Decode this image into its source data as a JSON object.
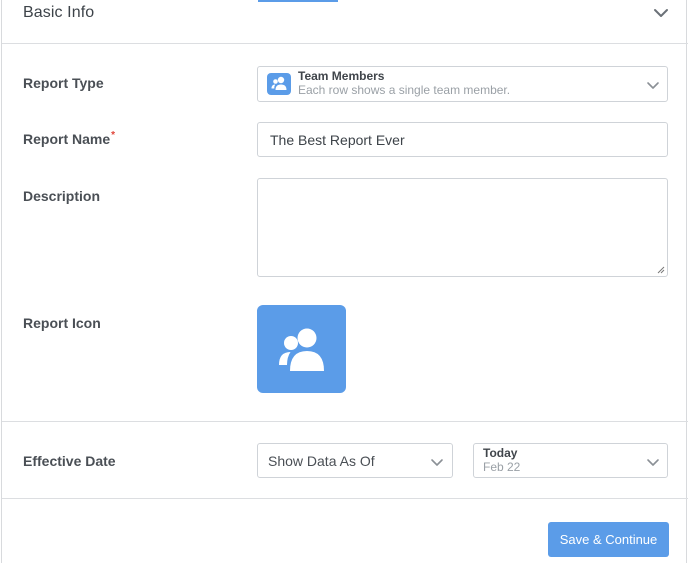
{
  "header": {
    "title": "Basic Info"
  },
  "fields": {
    "report_type": {
      "label": "Report Type",
      "selected_title": "Team Members",
      "selected_description": "Each row shows a single team member.",
      "icon": "team-members-icon"
    },
    "report_name": {
      "label": "Report Name",
      "required_marker": "*",
      "value": "The Best Report Ever"
    },
    "description": {
      "label": "Description",
      "value": ""
    },
    "report_icon": {
      "label": "Report Icon",
      "icon": "team-members-icon"
    },
    "effective_date": {
      "label": "Effective Date",
      "mode_value": "Show Data As Of",
      "date_title": "Today",
      "date_value": "Feb 22"
    }
  },
  "actions": {
    "save_label": "Save & Continue"
  },
  "colors": {
    "accent": "#5b9ce8",
    "required": "#e0453a",
    "border": "#cfd3d8"
  }
}
